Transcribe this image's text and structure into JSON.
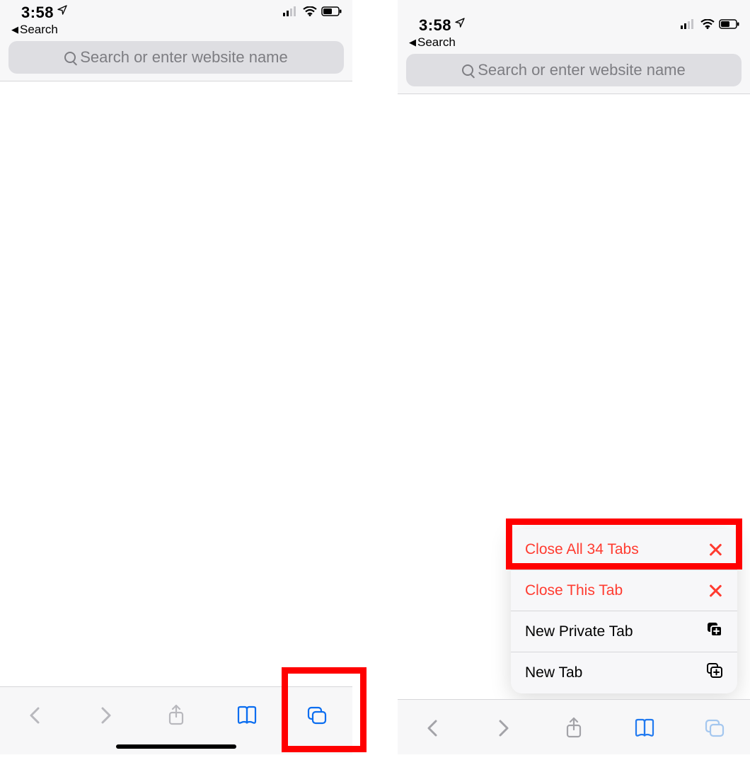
{
  "status": {
    "time": "3:58",
    "back_label": "Search"
  },
  "search": {
    "placeholder": "Search or enter website name"
  },
  "menu": {
    "close_all": "Close All 34 Tabs",
    "close_this": "Close This Tab",
    "new_private": "New Private Tab",
    "new_tab": "New Tab"
  }
}
